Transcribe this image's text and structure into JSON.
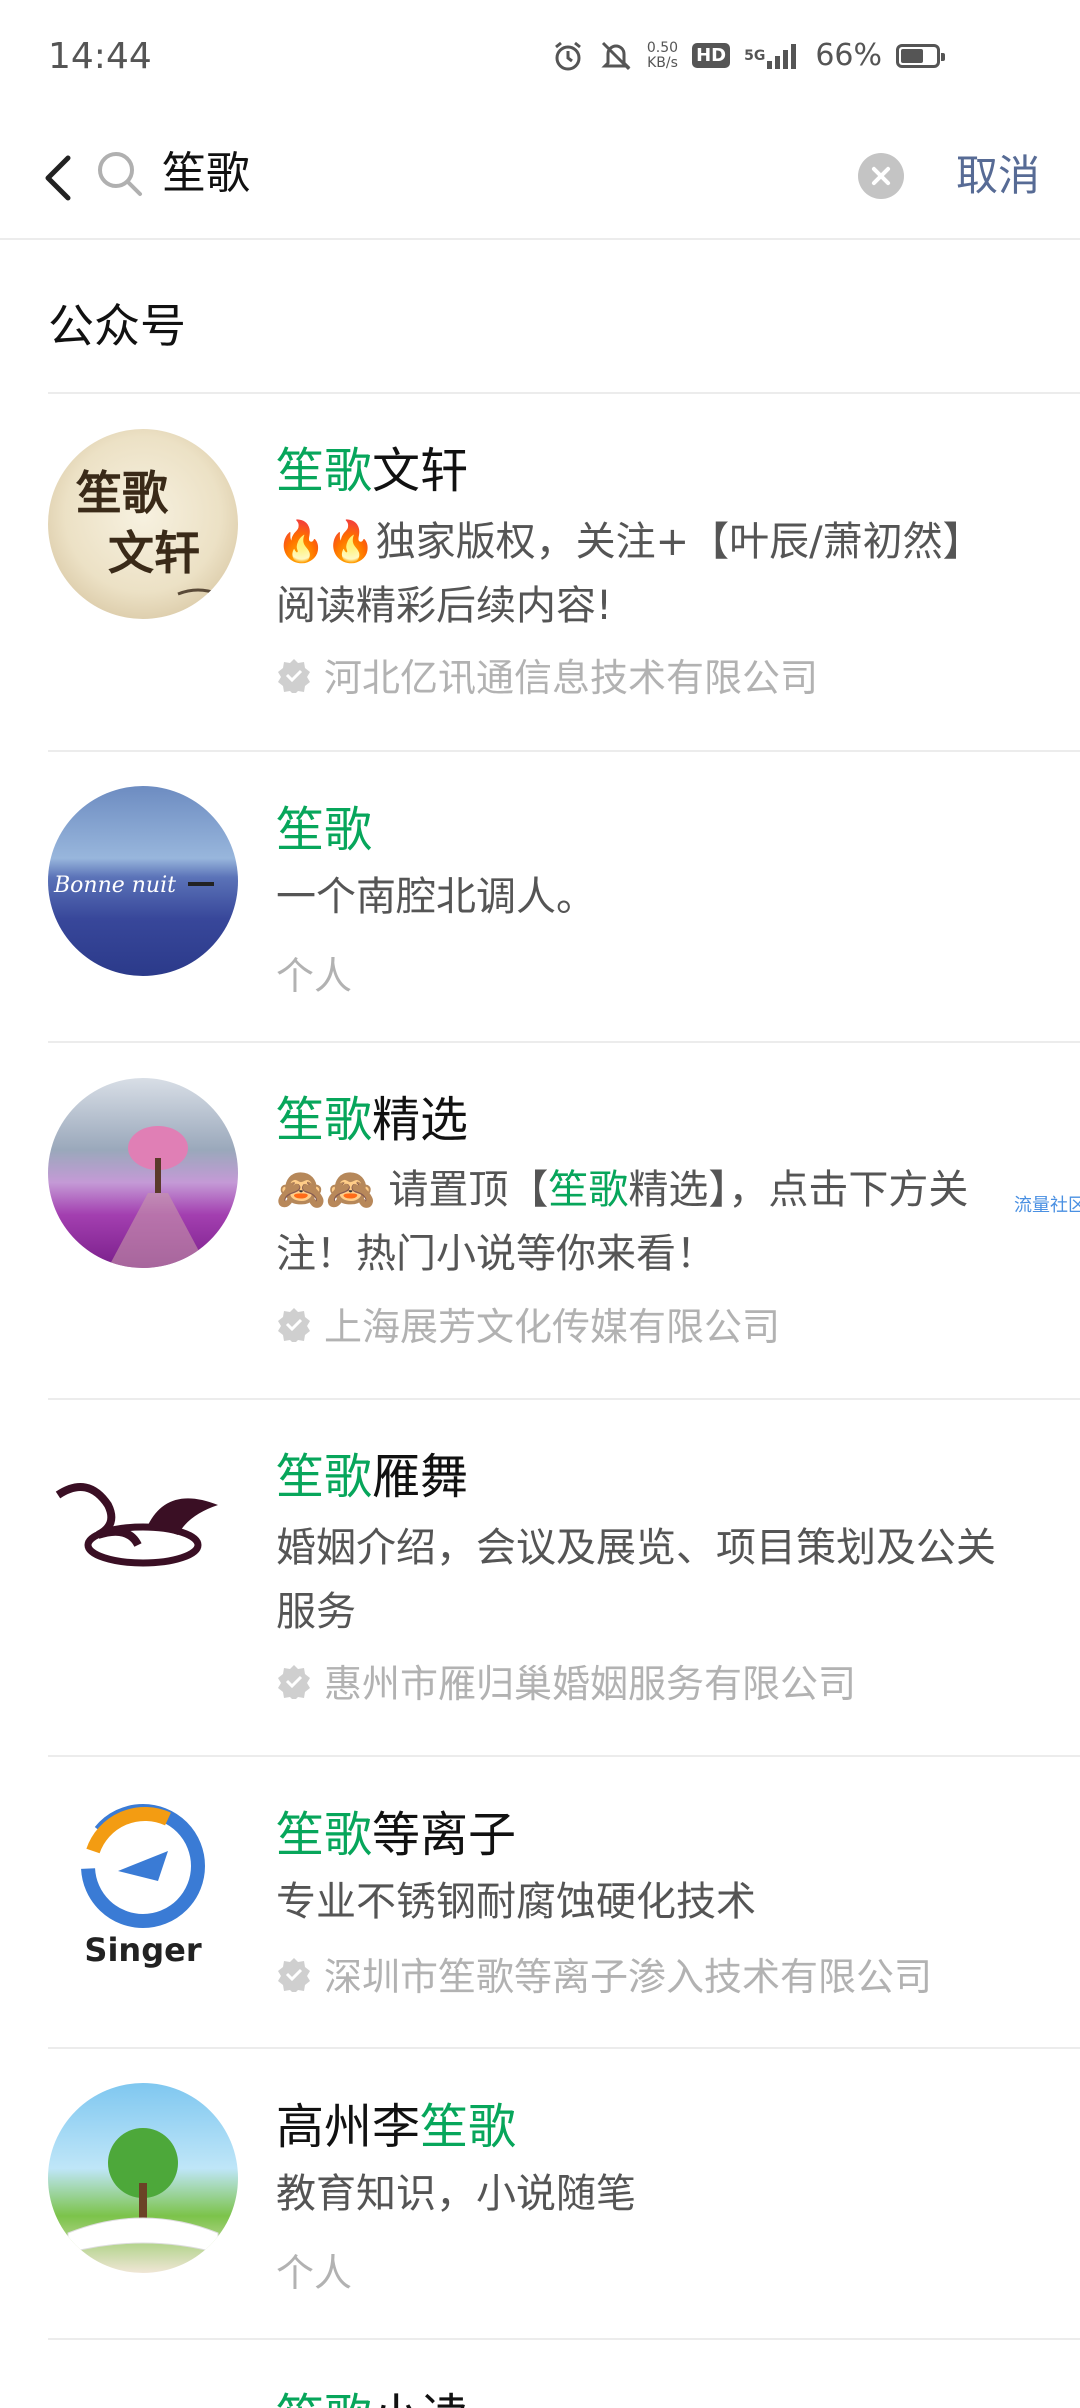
{
  "status_bar": {
    "time": "14:44",
    "speed_value": "0.50",
    "speed_unit": "KB/s",
    "hd": "HD",
    "network": "5G",
    "battery": "66%",
    "battery_level": 0.66,
    "icons": [
      "alarm-icon",
      "mute-icon",
      "signal-icon",
      "battery-icon"
    ]
  },
  "search": {
    "query": "笙歌",
    "cancel_label": "取消",
    "icons": [
      "back-icon",
      "search-icon",
      "clear-icon"
    ]
  },
  "section": {
    "title": "公众号"
  },
  "results": [
    {
      "title_hl": "笙歌",
      "title_rest": "文轩",
      "desc": "🔥🔥独家版权，关注+【叶辰/萧初然】阅读精彩后续内容!",
      "org": "河北亿讯通信息技术有限公司",
      "verified": true,
      "avatar_text_1": "笙歌",
      "avatar_text_2": "文轩"
    },
    {
      "title_hl": "笙歌",
      "title_rest": "",
      "desc": "一个南腔北调人。",
      "org": "个人",
      "verified": false,
      "avatar_text": "Bonne nuit"
    },
    {
      "title_hl": "笙歌",
      "title_rest": "精选",
      "desc_pre": "🙈🙈 请置顶【",
      "desc_hl": "笙歌",
      "desc_post": "精选】，点击下方关注！热门小说等你来看！",
      "org": "上海展芳文化传媒有限公司",
      "verified": true
    },
    {
      "title_hl": "笙歌",
      "title_rest": "雁舞",
      "desc": "婚姻介绍，会议及展览、项目策划及公关服务",
      "org": "惠州市雁归巢婚姻服务有限公司",
      "verified": true
    },
    {
      "title_hl": "笙歌",
      "title_rest": "等离子",
      "desc": "专业不锈钢耐腐蚀硬化技术",
      "org": "深圳市笙歌等离子渗入技术有限公司",
      "verified": true,
      "avatar_text": "Singer"
    },
    {
      "title_pre": "高州李",
      "title_hl": "笙歌",
      "desc": "教育知识，小说随笔",
      "org": "个人",
      "verified": false
    },
    {
      "title_hl": "笙歌",
      "title_rest": "小读"
    }
  ],
  "watermark": "流量社区",
  "colors": {
    "highlight": "#07a65b",
    "link": "#576b95",
    "muted": "#b2b2b2",
    "divider": "#ececec"
  }
}
